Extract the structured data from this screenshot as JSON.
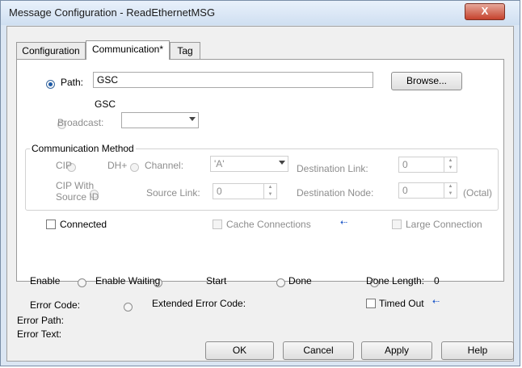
{
  "window": {
    "title": "Message Configuration - ReadEthernetMSG",
    "close_glyph": "X"
  },
  "tabs": [
    {
      "label": "Configuration"
    },
    {
      "label": "Communication*"
    },
    {
      "label": "Tag"
    }
  ],
  "path": {
    "label": "Path:",
    "value": "GSC",
    "resolved": "GSC",
    "browse_label": "Browse..."
  },
  "broadcast": {
    "label": "Broadcast:",
    "value": ""
  },
  "comm_method": {
    "group_label": "Communication Method",
    "cip_label": "CIP",
    "dhplus_label": "DH+",
    "channel_label": "Channel:",
    "channel_value": "'A'",
    "dest_link_label": "Destination Link:",
    "dest_link_value": "0",
    "cip_source_label_1": "CIP With",
    "cip_source_label_2": "Source ID",
    "source_link_label": "Source Link:",
    "source_link_value": "0",
    "dest_node_label": "Destination Node:",
    "dest_node_value": "0",
    "octal_label": "(Octal)"
  },
  "options": {
    "connected": "Connected",
    "cache": "Cache Connections",
    "large": "Large Connection",
    "arrow": "⇠"
  },
  "status": {
    "enable": "Enable",
    "enable_waiting": "Enable Waiting",
    "start": "Start",
    "done": "Done",
    "done_length_label": "Done Length:",
    "done_length_value": "0",
    "error_code": "Error Code:",
    "extended_error_code": "Extended Error Code:",
    "timed_out": "Timed Out",
    "timed_out_arrow": "⇠",
    "error_path": "Error Path:",
    "error_text": "Error Text:"
  },
  "buttons": {
    "ok": "OK",
    "cancel": "Cancel",
    "apply": "Apply",
    "help": "Help"
  }
}
